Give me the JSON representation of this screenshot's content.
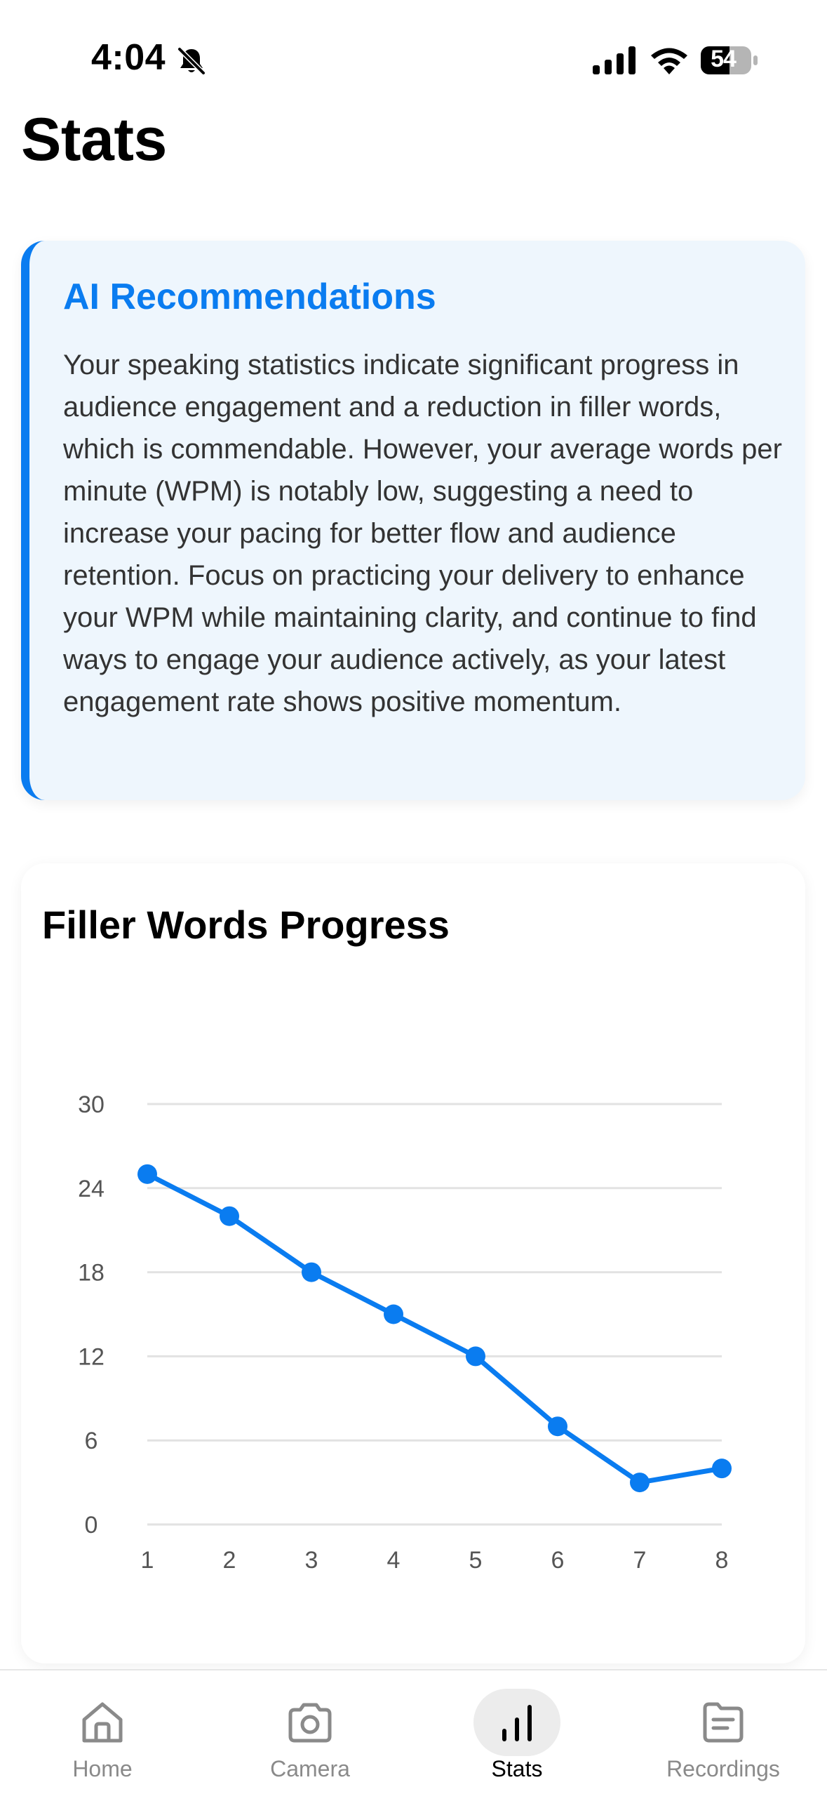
{
  "status_bar": {
    "time": "4:04",
    "battery": "54",
    "icons": [
      "bell-off-icon",
      "signal-icon",
      "wifi-icon",
      "battery-icon"
    ]
  },
  "page": {
    "title": "Stats"
  },
  "ai_card": {
    "title": "AI Recommendations",
    "body": "Your speaking statistics indicate significant progress in audience engagement and a reduction in filler words, which is commendable. However, your average words per minute (WPM) is notably low, suggesting a need to increase your pacing for better flow and audience retention. Focus on practicing your delivery to enhance your WPM while maintaining clarity, and continue to find ways to engage your audience actively, as your latest engagement rate shows positive momentum.",
    "accent_color": "#0a7cf0"
  },
  "chart_card": {
    "title": "Filler Words Progress"
  },
  "chart_data": {
    "type": "line",
    "title": "Filler Words Progress",
    "x": [
      1,
      2,
      3,
      4,
      5,
      6,
      7,
      8
    ],
    "series": [
      {
        "values": [
          25,
          22,
          18,
          15,
          12,
          7,
          3,
          4
        ],
        "color": "#0a7cf0"
      }
    ],
    "x_ticks": [
      "1",
      "2",
      "3",
      "4",
      "5",
      "6",
      "7",
      "8"
    ],
    "y_ticks": [
      "0",
      "6",
      "12",
      "18",
      "24",
      "30"
    ],
    "ylim": [
      0,
      30
    ],
    "grid": true,
    "xlabel": "",
    "ylabel": ""
  },
  "tab_bar": {
    "tabs": [
      {
        "label": "Home",
        "icon": "home-icon",
        "active": false
      },
      {
        "label": "Camera",
        "icon": "camera-icon",
        "active": false
      },
      {
        "label": "Stats",
        "icon": "stats-icon",
        "active": true
      },
      {
        "label": "Recordings",
        "icon": "document-icon",
        "active": false
      }
    ]
  }
}
